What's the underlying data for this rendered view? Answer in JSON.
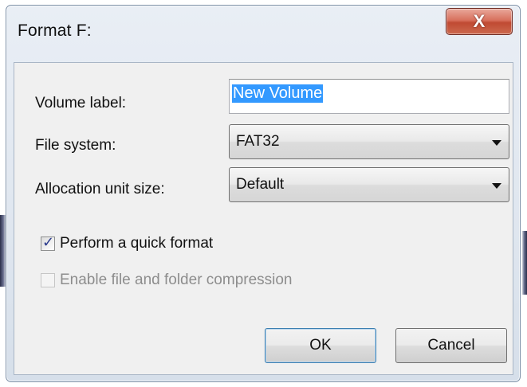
{
  "window": {
    "title": "Format F:",
    "close_glyph": "X"
  },
  "form": {
    "volume_label": {
      "label": "Volume label:",
      "value": "New Volume"
    },
    "file_system": {
      "label": "File system:",
      "selected": "FAT32"
    },
    "allocation_unit_size": {
      "label": "Allocation unit size:",
      "selected": "Default"
    }
  },
  "options": {
    "quick_format": {
      "label": "Perform a quick format",
      "checked": true,
      "enabled": true
    },
    "compression": {
      "label": "Enable file and folder compression",
      "checked": false,
      "enabled": false
    }
  },
  "buttons": {
    "ok_label": "OK",
    "cancel_label": "Cancel"
  },
  "colors": {
    "close_button": "#c04a33",
    "selection_highlight": "#3399ff",
    "dialog_background": "#f0f0f0"
  },
  "icons": {
    "close": "close-icon",
    "dropdown": "chevron-down-icon",
    "check": "checkmark-icon"
  }
}
